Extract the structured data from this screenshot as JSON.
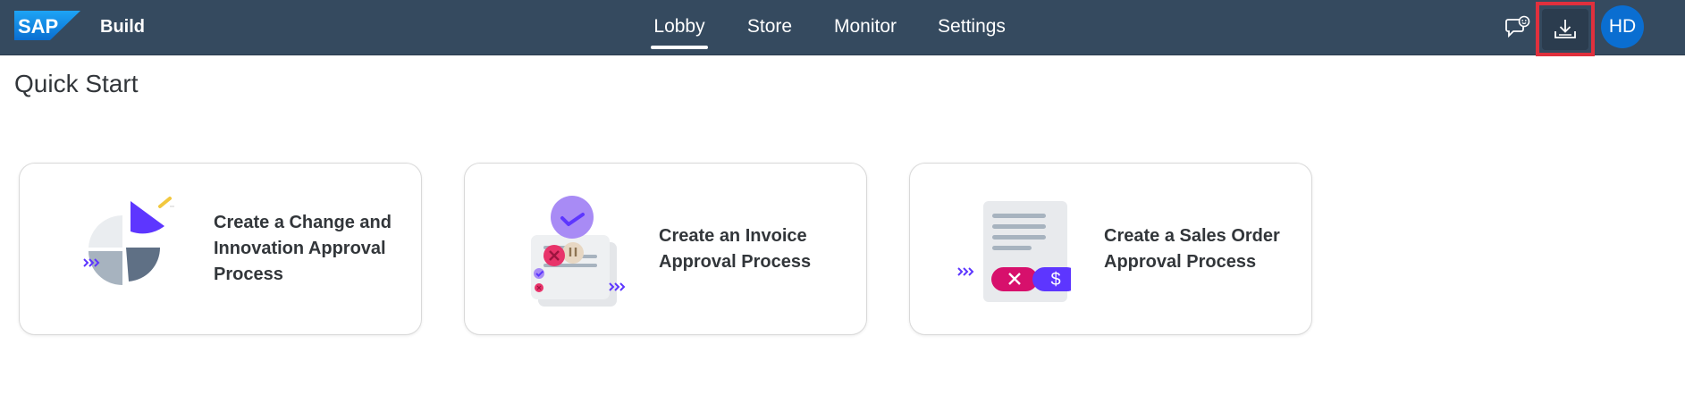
{
  "header": {
    "logo_text": "SAP",
    "app_title": "Build",
    "tabs": [
      {
        "label": "Lobby",
        "active": true
      },
      {
        "label": "Store",
        "active": false
      },
      {
        "label": "Monitor",
        "active": false
      },
      {
        "label": "Settings",
        "active": false
      }
    ],
    "avatar_initials": "HD",
    "icons": {
      "feedback": "feedback-icon",
      "download": "download-icon"
    }
  },
  "main": {
    "title": "Quick Start",
    "cards": [
      {
        "label": "Create a Change and Innovation Approval Process",
        "icon": "pie-chart-illustration"
      },
      {
        "label": "Create an Invoice Approval Process",
        "icon": "invoice-illustration"
      },
      {
        "label": "Create a Sales Order Approval Process",
        "icon": "sales-order-illustration"
      }
    ]
  },
  "colors": {
    "shellbar": "#354a5f",
    "accent_purple": "#5d36ff",
    "highlight_border": "#e0303d",
    "avatar": "#0a6ed1"
  }
}
